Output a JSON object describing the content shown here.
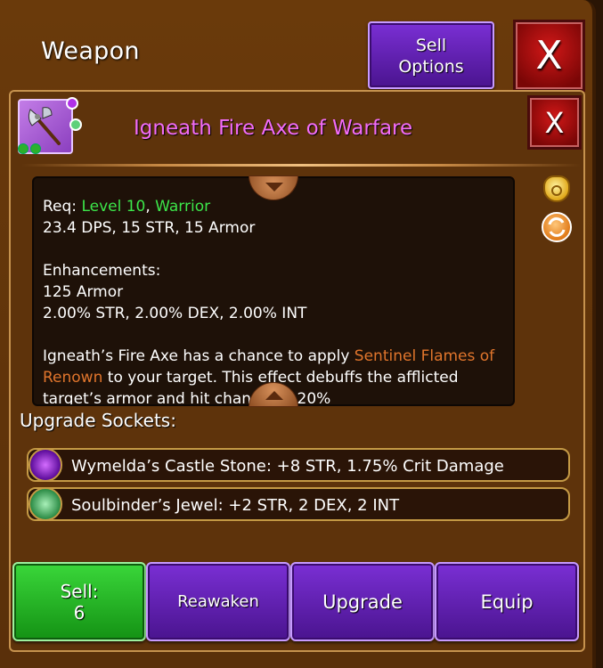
{
  "window": {
    "title": "Weapon",
    "sell_options_line1": "Sell",
    "sell_options_line2": "Options",
    "close_label": "X"
  },
  "item": {
    "name": "Igneath Fire Axe of Warfare",
    "close_label": "X",
    "req_prefix": "Req: ",
    "req_level": "Level 10",
    "req_sep": ", ",
    "req_class": "Warrior",
    "stats": "23.4 DPS, 15 STR, 15 Armor",
    "enh_title": "Enhancements:",
    "enh_line1": "125 Armor",
    "enh_line2": "2.00% STR, 2.00% DEX, 2.00% INT",
    "lore_part1": "Igneath’s Fire Axe has a chance to apply ",
    "lore_link": "Sentinel Flames of Renown",
    "lore_part2": " to your target. This effect debuffs the afflicted target’s armor and hit chance by 20%"
  },
  "sockets": {
    "title": "Upgrade Sockets:",
    "items": [
      {
        "label": "Wymelda’s Castle Stone: +8 STR, 1.75% Crit Damage",
        "gem_color": "#a020e0"
      },
      {
        "label": "Soulbinder’s Jewel: +2 STR, 2 DEX, 2 INT",
        "gem_color": "#4fd07a"
      }
    ]
  },
  "actions": {
    "sell_label": "Sell:",
    "sell_value": "6",
    "reawaken": "Reawaken",
    "upgrade": "Upgrade",
    "equip": "Equip"
  },
  "icons": {
    "item": "battle-axe-icon",
    "coin_bag": "coin-bag-icon",
    "swap": "swap-arrows-icon"
  },
  "colors": {
    "item_name": "#f26cf8",
    "requirement": "#3ce64a",
    "effect_link": "#e0752c",
    "button_purple": "#5a1ba8",
    "button_green": "#22b322",
    "close_red": "#c01414"
  }
}
